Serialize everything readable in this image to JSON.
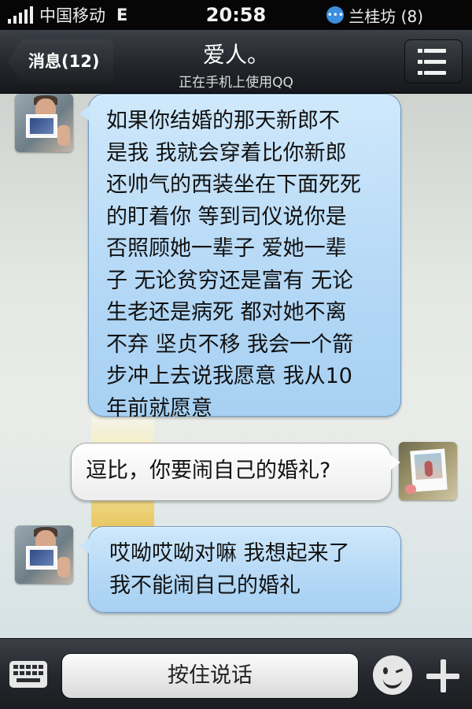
{
  "status_bar": {
    "carrier": "中国移动",
    "network": "E",
    "time": "20:58",
    "notification_text": "兰桂坊 (8)"
  },
  "nav": {
    "back_label": "消息(12)",
    "title": "爱人。",
    "subtitle": "正在手机上使用QQ"
  },
  "messages": [
    {
      "side": "left",
      "text": "如果你结婚的那天新郎不\n是我 我就会穿着比你新郎\n还帅气的西装坐在下面死死\n的盯着你 等到司仪说你是\n否照顾她一辈子 爱她一辈\n子 无论贫穷还是富有 无论\n生老还是病死 都对她不离\n不弃 坚贞不移 我会一个箭\n步冲上去说我愿意 我从10\n年前就愿意"
    },
    {
      "side": "right",
      "text": "逗比，你要闹自己的婚礼?"
    },
    {
      "side": "left",
      "text": "哎呦哎呦对嘛 我想起来了\n我不能闹自己的婚礼"
    }
  ],
  "input_bar": {
    "hold_to_talk_label": "按住说话"
  },
  "icons": {
    "keyboard": "keyboard-icon",
    "emoji": "emoji-icon",
    "plus": "plus-icon",
    "menu": "menu-icon",
    "chat_notification": "qq-chat-icon"
  },
  "colors": {
    "bubble_incoming": "#b4d8f6",
    "bubble_outgoing": "#f4f4f4",
    "bar_dark": "#23262b"
  }
}
